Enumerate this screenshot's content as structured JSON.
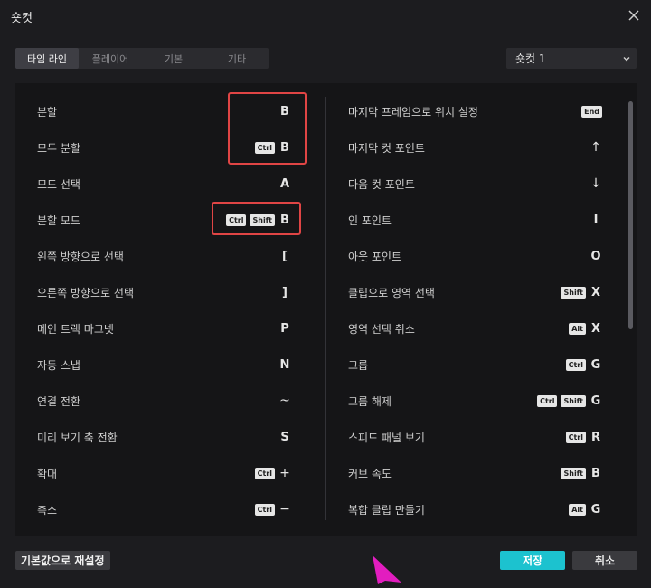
{
  "window": {
    "title": "숏컷"
  },
  "tabs": [
    {
      "label": "타임 라인",
      "active": true
    },
    {
      "label": "플레이어",
      "active": false
    },
    {
      "label": "기본",
      "active": false
    },
    {
      "label": "기타",
      "active": false
    }
  ],
  "preset_dropdown": {
    "value": "숏컷 1"
  },
  "left_shortcuts": [
    {
      "label": "분할",
      "modifiers": [],
      "key": "B"
    },
    {
      "label": "모두 분할",
      "modifiers": [
        "Ctrl"
      ],
      "key": "B"
    },
    {
      "label": "모드 선택",
      "modifiers": [],
      "key": "A"
    },
    {
      "label": "분할 모드",
      "modifiers": [
        "Ctrl",
        "Shift"
      ],
      "key": "B"
    },
    {
      "label": "왼쪽 방향으로 선택",
      "modifiers": [],
      "key": "["
    },
    {
      "label": "오른쪽 방향으로 선택",
      "modifiers": [],
      "key": "]"
    },
    {
      "label": "메인 트랙 마그넷",
      "modifiers": [],
      "key": "P"
    },
    {
      "label": "자동 스냅",
      "modifiers": [],
      "key": "N"
    },
    {
      "label": "연결 전환",
      "modifiers": [],
      "key": "~"
    },
    {
      "label": "미리 보기 축 전환",
      "modifiers": [],
      "key": "S"
    },
    {
      "label": "확대",
      "modifiers": [
        "Ctrl"
      ],
      "key": "+"
    },
    {
      "label": "축소",
      "modifiers": [
        "Ctrl"
      ],
      "key": "−"
    }
  ],
  "right_shortcuts": [
    {
      "label": "마지막 프레임으로 위치 설정",
      "modifiers": [
        "End"
      ],
      "key": ""
    },
    {
      "label": "마지막 컷 포인트",
      "modifiers": [],
      "key": "↑"
    },
    {
      "label": "다음 컷 포인트",
      "modifiers": [],
      "key": "↓"
    },
    {
      "label": "인 포인트",
      "modifiers": [],
      "key": "I"
    },
    {
      "label": "아웃 포인트",
      "modifiers": [],
      "key": "O"
    },
    {
      "label": "클립으로 영역 선택",
      "modifiers": [
        "Shift"
      ],
      "key": "X"
    },
    {
      "label": "영역 선택 취소",
      "modifiers": [
        "Alt"
      ],
      "key": "X"
    },
    {
      "label": "그룹",
      "modifiers": [
        "Ctrl"
      ],
      "key": "G"
    },
    {
      "label": "그룹 해제",
      "modifiers": [
        "Ctrl",
        "Shift"
      ],
      "key": "G"
    },
    {
      "label": "스피드 패널 보기",
      "modifiers": [
        "Ctrl"
      ],
      "key": "R"
    },
    {
      "label": "커브 속도",
      "modifiers": [
        "Shift"
      ],
      "key": "B"
    },
    {
      "label": "복합 클립 만들기",
      "modifiers": [
        "Alt"
      ],
      "key": "G"
    }
  ],
  "footer": {
    "reset_label": "기본값으로 재설정",
    "save_label": "저장",
    "cancel_label": "취소"
  },
  "colors": {
    "accent": "#1cc2cf",
    "highlight": "#e04545",
    "cursor": "#e21dbf"
  }
}
